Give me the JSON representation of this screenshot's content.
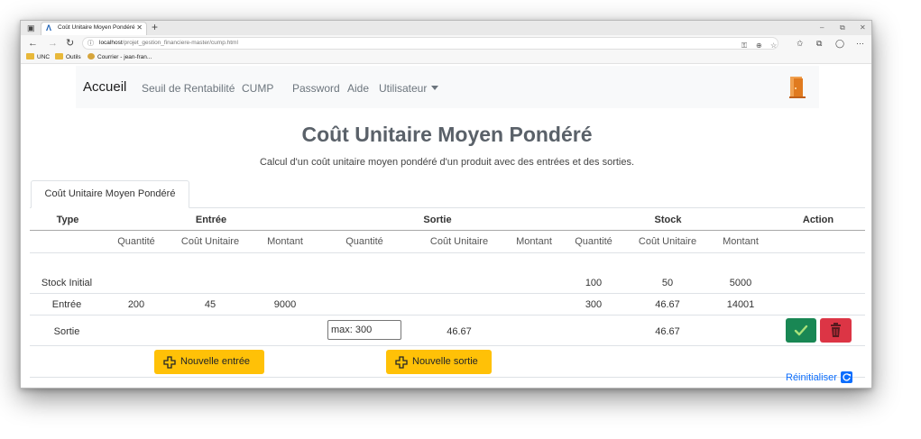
{
  "browser": {
    "tab_title": "Coût Unitaire Moyen Pondéré",
    "url_host": "localhost",
    "url_path": "/projet_gestion_financiere-master/cump.html",
    "bookmarks": [
      "UNC",
      "Outils",
      "Courrier - jean-fran..."
    ]
  },
  "navbar": {
    "brand": "Accueil",
    "links": [
      "Seuil de Rentabilité",
      "CUMP",
      "Password",
      "Aide",
      "Utilisateur"
    ]
  },
  "header": {
    "title": "Coût Unitaire Moyen Pondéré",
    "lead": "Calcul d'un coût unitaire moyen pondéré d'un produit avec des entrées et des sorties."
  },
  "tab_label": "Coût Unitaire Moyen Pondéré",
  "table": {
    "group_headers": [
      "Type",
      "Entrée",
      "Sortie",
      "Stock",
      "Action"
    ],
    "sub_headers": [
      "Quantité",
      "Coût Unitaire",
      "Montant",
      "Quantité",
      "Coût Unitaire",
      "Montant",
      "Quantité",
      "Coût Unitaire",
      "Montant"
    ],
    "rows": [
      {
        "type": "Stock Initial",
        "stock_qty": "100",
        "stock_cu": "50",
        "stock_amount": "5000"
      },
      {
        "type": "Entrée",
        "entree_qty": "200",
        "entree_cu": "45",
        "entree_amount": "9000",
        "stock_qty": "300",
        "stock_cu": "46.67",
        "stock_amount": "14001"
      },
      {
        "type": "Sortie",
        "sortie_placeholder": "max: 300",
        "sortie_cu": "46.67",
        "stock_cu": "46.67"
      }
    ]
  },
  "buttons": {
    "new_entry": "Nouvelle entrée",
    "new_exit": "Nouvelle sortie",
    "reset": "Réinitialiser"
  },
  "colors": {
    "success": "#198754",
    "danger": "#dc3545",
    "warning": "#ffc107",
    "link": "#0d6efd"
  }
}
